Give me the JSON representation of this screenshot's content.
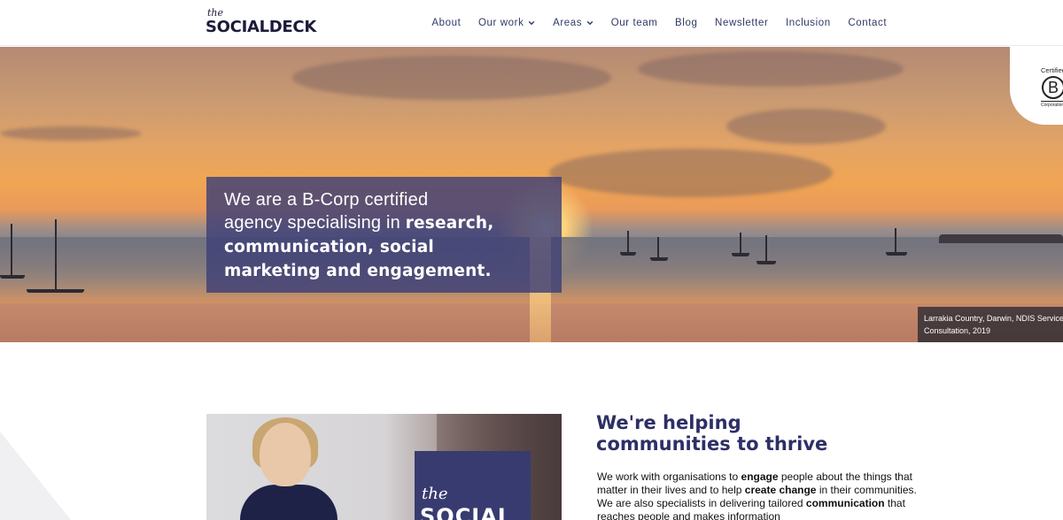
{
  "logo": {
    "small": "the",
    "word": "SOCIALDECK"
  },
  "nav": {
    "items": [
      {
        "label": "About"
      },
      {
        "label": "Our work"
      },
      {
        "label": "Areas"
      },
      {
        "label": "Our team"
      },
      {
        "label": "Blog"
      },
      {
        "label": "Newsletter"
      },
      {
        "label": "Inclusion"
      },
      {
        "label": "Contact"
      }
    ]
  },
  "badge": {
    "certified": "Certified",
    "letter": "B",
    "corporation": "Corporation"
  },
  "hero": {
    "line1": "We are a B-Corp certified",
    "line2_plain": "agency specialising in ",
    "line2_bold": "research,",
    "line3_bold": "communication, social",
    "line4_bold": "marketing and engagement."
  },
  "caption": {
    "line1": "Larrakia Country, Darwin, NDIS Service",
    "line2": "Consultation, 2019"
  },
  "photo_card": {
    "small": "the",
    "word": "SOCIAL"
  },
  "intro": {
    "title_line1": "We're helping",
    "title_line2": "communities to thrive",
    "t1": "We work with organisations to ",
    "b1": "engage",
    "t2": " people about the things that matter in their lives and to help ",
    "b2": "create change",
    "t3": " in their communities. We are also specialists in delivering tailored ",
    "b3": "communication",
    "t4": " that reaches people and makes information"
  }
}
